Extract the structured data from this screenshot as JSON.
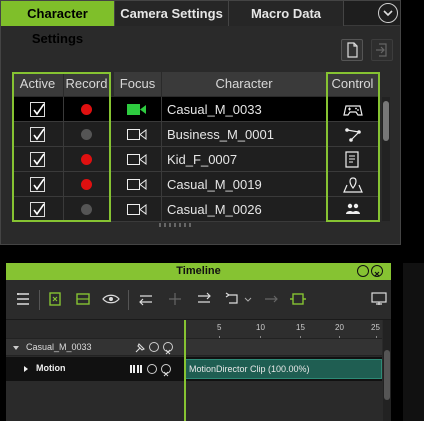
{
  "tabs": [
    {
      "label": "Character Settings",
      "active": true
    },
    {
      "label": "Camera Settings",
      "active": false
    },
    {
      "label": "Macro Data",
      "active": false
    }
  ],
  "table": {
    "headers": {
      "active": "Active",
      "record": "Record",
      "focus": "Focus",
      "character": "Character",
      "control": "Control"
    },
    "rows": [
      {
        "active": true,
        "record": "red",
        "focus": "green-camera",
        "character": "Casual_M_0033",
        "control": "gamepad-icon",
        "selected": true
      },
      {
        "active": true,
        "record": "gray",
        "focus": "white-camera",
        "character": "Business_M_0001",
        "control": "path-icon",
        "selected": false
      },
      {
        "active": true,
        "record": "red",
        "focus": "white-camera",
        "character": "Kid_F_0007",
        "control": "script-icon",
        "selected": false
      },
      {
        "active": true,
        "record": "red",
        "focus": "white-camera",
        "character": "Casual_M_0019",
        "control": "map-pin-icon",
        "selected": false
      },
      {
        "active": true,
        "record": "gray",
        "focus": "white-camera",
        "character": "Casual_M_0026",
        "control": "crowd-icon",
        "selected": false
      }
    ]
  },
  "timeline": {
    "title": "Timeline",
    "ruler_ticks": [
      "5",
      "10",
      "15",
      "20",
      "25"
    ],
    "track_character": "Casual_M_0033",
    "track_motion": "Motion",
    "clip_label": "MotionDirector Clip (100.00%)"
  },
  "colors": {
    "accent": "#86c332",
    "record_on": "#e01010",
    "record_off": "#555555",
    "clip": "#1f5e52"
  }
}
